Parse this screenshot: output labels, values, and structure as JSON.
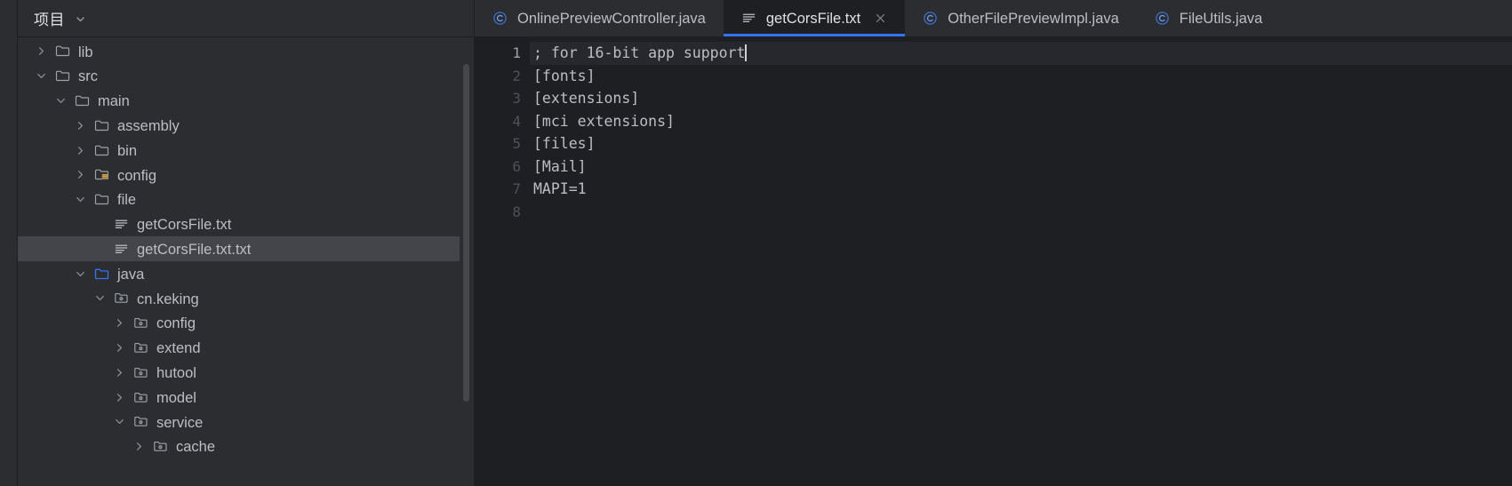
{
  "sidebar": {
    "title": "项目",
    "chevron_icon": "chevron-down-icon",
    "tree": [
      {
        "label": "lib",
        "indent": 1,
        "twisty": "collapsed",
        "icon": "folder-icon",
        "selected": false
      },
      {
        "label": "src",
        "indent": 1,
        "twisty": "expanded",
        "icon": "folder-icon",
        "selected": false
      },
      {
        "label": "main",
        "indent": 2,
        "twisty": "expanded",
        "icon": "folder-icon",
        "selected": false
      },
      {
        "label": "assembly",
        "indent": 3,
        "twisty": "collapsed",
        "icon": "folder-icon",
        "selected": false
      },
      {
        "label": "bin",
        "indent": 3,
        "twisty": "collapsed",
        "icon": "folder-icon",
        "selected": false
      },
      {
        "label": "config",
        "indent": 3,
        "twisty": "collapsed",
        "icon": "resources-folder-icon",
        "selected": false
      },
      {
        "label": "file",
        "indent": 3,
        "twisty": "expanded",
        "icon": "folder-icon",
        "selected": false
      },
      {
        "label": "getCorsFile.txt",
        "indent": 4,
        "twisty": "none",
        "icon": "text-file-icon",
        "selected": false
      },
      {
        "label": "getCorsFile.txt.txt",
        "indent": 4,
        "twisty": "none",
        "icon": "text-file-icon",
        "selected": true
      },
      {
        "label": "java",
        "indent": 3,
        "twisty": "expanded",
        "icon": "source-root-folder-icon",
        "selected": false
      },
      {
        "label": "cn.keking",
        "indent": 4,
        "twisty": "expanded",
        "icon": "package-icon",
        "selected": false
      },
      {
        "label": "config",
        "indent": 5,
        "twisty": "collapsed",
        "icon": "package-icon",
        "selected": false
      },
      {
        "label": "extend",
        "indent": 5,
        "twisty": "collapsed",
        "icon": "package-icon",
        "selected": false
      },
      {
        "label": "hutool",
        "indent": 5,
        "twisty": "collapsed",
        "icon": "package-icon",
        "selected": false
      },
      {
        "label": "model",
        "indent": 5,
        "twisty": "collapsed",
        "icon": "package-icon",
        "selected": false
      },
      {
        "label": "service",
        "indent": 5,
        "twisty": "expanded",
        "icon": "package-icon",
        "selected": false
      },
      {
        "label": "cache",
        "indent": 6,
        "twisty": "collapsed",
        "icon": "package-icon",
        "selected": false
      }
    ]
  },
  "editor": {
    "tabs": [
      {
        "label": "OnlinePreviewController.java",
        "icon": "java-class-icon",
        "active": false,
        "closable": false
      },
      {
        "label": "getCorsFile.txt",
        "icon": "text-file-icon",
        "active": true,
        "closable": true
      },
      {
        "label": "OtherFilePreviewImpl.java",
        "icon": "java-class-icon",
        "active": false,
        "closable": false
      },
      {
        "label": "FileUtils.java",
        "icon": "java-class-icon",
        "active": false,
        "closable": false
      }
    ],
    "close_icon": "close-icon",
    "line_numbers": [
      "1",
      "2",
      "3",
      "4",
      "5",
      "6",
      "7",
      "8"
    ],
    "lines": [
      "; for 16-bit app support",
      "[fonts]",
      "[extensions]",
      "[mci extensions]",
      "[files]",
      "[Mail]",
      "MAPI=1",
      ""
    ],
    "caret_line": 1
  },
  "colors": {
    "background": "#2b2d30",
    "editor_background": "#1e1f22",
    "selection": "#43454a",
    "accent": "#3574f0",
    "text": "#bcbec4",
    "text_bright": "#dfe1e5",
    "line_number": "#4e5157",
    "resource_orange": "#d9a343",
    "source_blue": "#3573f0"
  }
}
